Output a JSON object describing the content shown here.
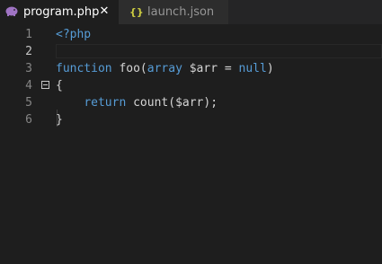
{
  "tabs": [
    {
      "label": "program.php",
      "icon": "php-elephant-icon",
      "active": true,
      "close_glyph": "✕"
    },
    {
      "label": "launch.json",
      "icon": "json-braces-icon",
      "active": false
    }
  ],
  "tab_icons": {
    "php_glyph": "🐘",
    "json_glyph": "{}"
  },
  "colors": {
    "keyword": "#569cd6",
    "default_text": "#d4d4d4",
    "json_icon": "#cbcb41",
    "php_icon": "#a074c4"
  },
  "editor": {
    "current_line": 2,
    "lines": [
      {
        "number": "1",
        "tokens": [
          {
            "t": "<?php",
            "k": "kw"
          }
        ]
      },
      {
        "number": "2",
        "tokens": []
      },
      {
        "number": "3",
        "tokens": [
          {
            "t": "function",
            "k": "kw"
          },
          {
            "t": " foo(",
            "k": "punc"
          },
          {
            "t": "array",
            "k": "kw"
          },
          {
            "t": " $arr = ",
            "k": "var"
          },
          {
            "t": "null",
            "k": "kw"
          },
          {
            "t": ")",
            "k": "punc"
          }
        ]
      },
      {
        "number": "4",
        "tokens": [
          {
            "t": "{",
            "k": "punc"
          }
        ]
      },
      {
        "number": "5",
        "tokens": [
          {
            "t": "    ",
            "k": "punc"
          },
          {
            "t": "return",
            "k": "kw"
          },
          {
            "t": " count($arr);",
            "k": "punc"
          }
        ]
      },
      {
        "number": "6",
        "tokens": [
          {
            "t": "}",
            "k": "punc"
          }
        ]
      }
    ]
  }
}
